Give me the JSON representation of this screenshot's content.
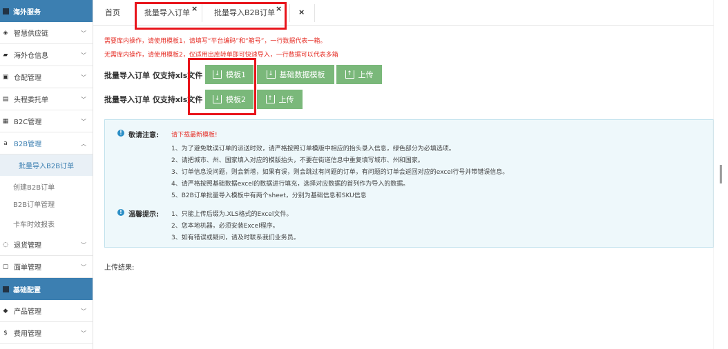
{
  "sidebar": {
    "section1": "海外服务",
    "items1": [
      {
        "label": "智慧供应链",
        "icon": "supply-chain-icon",
        "glyph": "◈"
      },
      {
        "label": "海外仓信息",
        "icon": "truck-icon",
        "glyph": "▰"
      },
      {
        "label": "仓配管理",
        "icon": "warehouse-icon",
        "glyph": "▣"
      },
      {
        "label": "头程委托单",
        "icon": "ship-icon",
        "glyph": "▤"
      },
      {
        "label": "B2C管理",
        "icon": "list-icon",
        "glyph": "▦"
      },
      {
        "label": "B2B管理",
        "icon": "b2b-icon",
        "glyph": "a"
      }
    ],
    "sub_items": [
      "批量导入B2B订单",
      "创建B2B订单",
      "B2B订单管理",
      "卡车时效报表"
    ],
    "items2": [
      {
        "label": "退货管理",
        "icon": "return-icon",
        "glyph": "◌"
      },
      {
        "label": "面单管理",
        "icon": "label-icon",
        "glyph": "▢"
      }
    ],
    "section2": "基础配置",
    "items3": [
      {
        "label": "产品管理",
        "icon": "tag-icon",
        "glyph": "◆"
      },
      {
        "label": "费用管理",
        "icon": "dollar-icon",
        "glyph": "$"
      }
    ]
  },
  "tabs": {
    "home": "首页",
    "t1": "批量导入订单",
    "t2": "批量导入B2B订单",
    "close": "×"
  },
  "notes": {
    "line1": "需要库内操作，请使用模板1，请填写“平台编码”和“箱号”，一行数据代表一箱。",
    "line2": "无需库内操作，请使用模板2，仅适用出库转单即可快速导入，一行数据可以代表多箱"
  },
  "import1": {
    "label": "批量导入订单 仅支持xls文件",
    "btn_template": "模板1",
    "btn_basic": "基础数据模板",
    "btn_upload": "上传"
  },
  "import2": {
    "label": "批量导入订单 仅支持xls文件",
    "btn_template": "模板2",
    "btn_upload": "上传"
  },
  "notice": {
    "title1": "敬请注意:",
    "alert": "请下载最新模板!",
    "items1": [
      "1、为了避免耽误订单的派送时效，请严格按照订单模版中相应的抬头录入信息，绿色部分为必填选项。",
      "2、请把城市、州、国家填入对应的模版抬头，不要在街道信息中重复填写城市、州和国家。",
      "3、订单信息没问题，则会新增，如果有误，则会跳过有问题的订单，有问题的订单会返回对应的excel行号并带错误信息。",
      "4、请严格按照基础数据excel的数据进行填充，选择对应数据的首列作为导入的数据。",
      "5、B2B订单批量导入模板中有两个sheet，分别为基础信息和SKU信息"
    ],
    "title2": "温馨提示:",
    "items2": [
      "1、只能上传后缀为.XLS格式的Excel文件。",
      "2、您本地机器，必须安装Excel程序。",
      "3、如有错误或疑问，请及时联系我们业务员。"
    ]
  },
  "result_label": "上传结果:",
  "colors": {
    "brand": "#3c7fb1",
    "button": "#7ab87a",
    "alert": "#e6322a",
    "highlight": "#e8141b"
  }
}
